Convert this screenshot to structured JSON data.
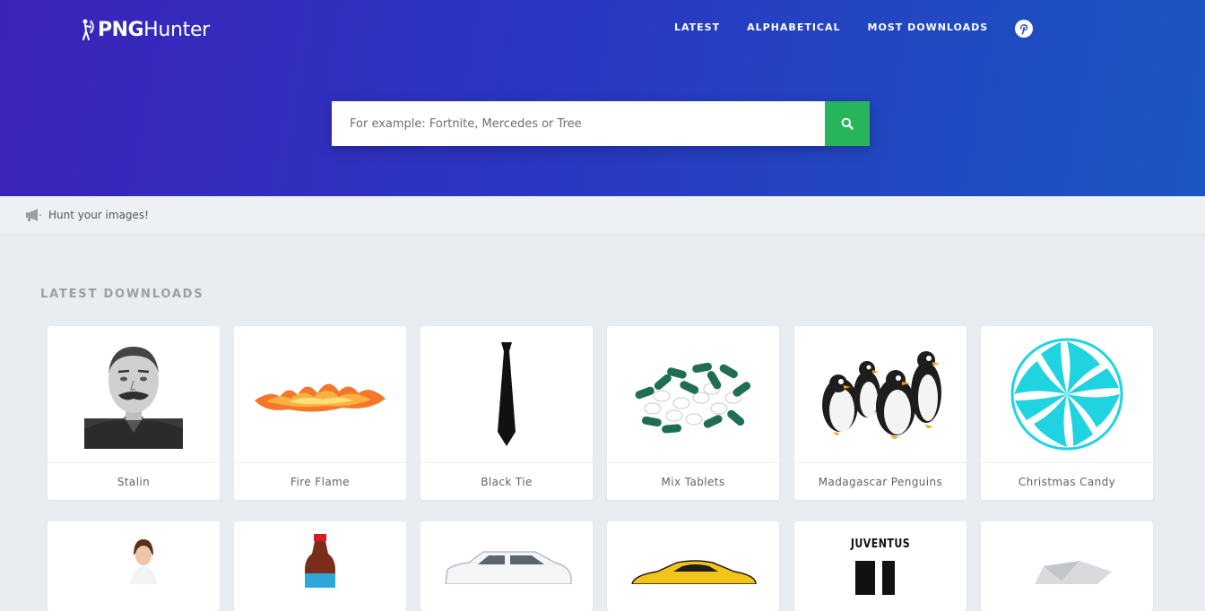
{
  "brand": {
    "name_bold": "PNG",
    "name_light": "Hunter"
  },
  "nav": {
    "latest": "LATEST",
    "alphabetical": "ALPHABETICAL",
    "most_downloads": "MOST DOWNLOADS"
  },
  "search": {
    "placeholder": "For example: Fortnite, Mercedes or Tree"
  },
  "notice": {
    "text": "Hunt your images!"
  },
  "section": {
    "title": "LATEST DOWNLOADS"
  },
  "cards": [
    {
      "caption": "Stalin"
    },
    {
      "caption": "Fire Flame"
    },
    {
      "caption": "Black Tie"
    },
    {
      "caption": "Mix Tablets"
    },
    {
      "caption": "Madagascar Penguins"
    },
    {
      "caption": "Christmas Candy"
    }
  ],
  "second_row": {
    "juventus_label": "JUVENTUS"
  },
  "colors": {
    "hero_start": "#3b23b9",
    "hero_end": "#1a56c0",
    "search_button": "#27b45a",
    "page_bg": "#e9ecf0"
  }
}
